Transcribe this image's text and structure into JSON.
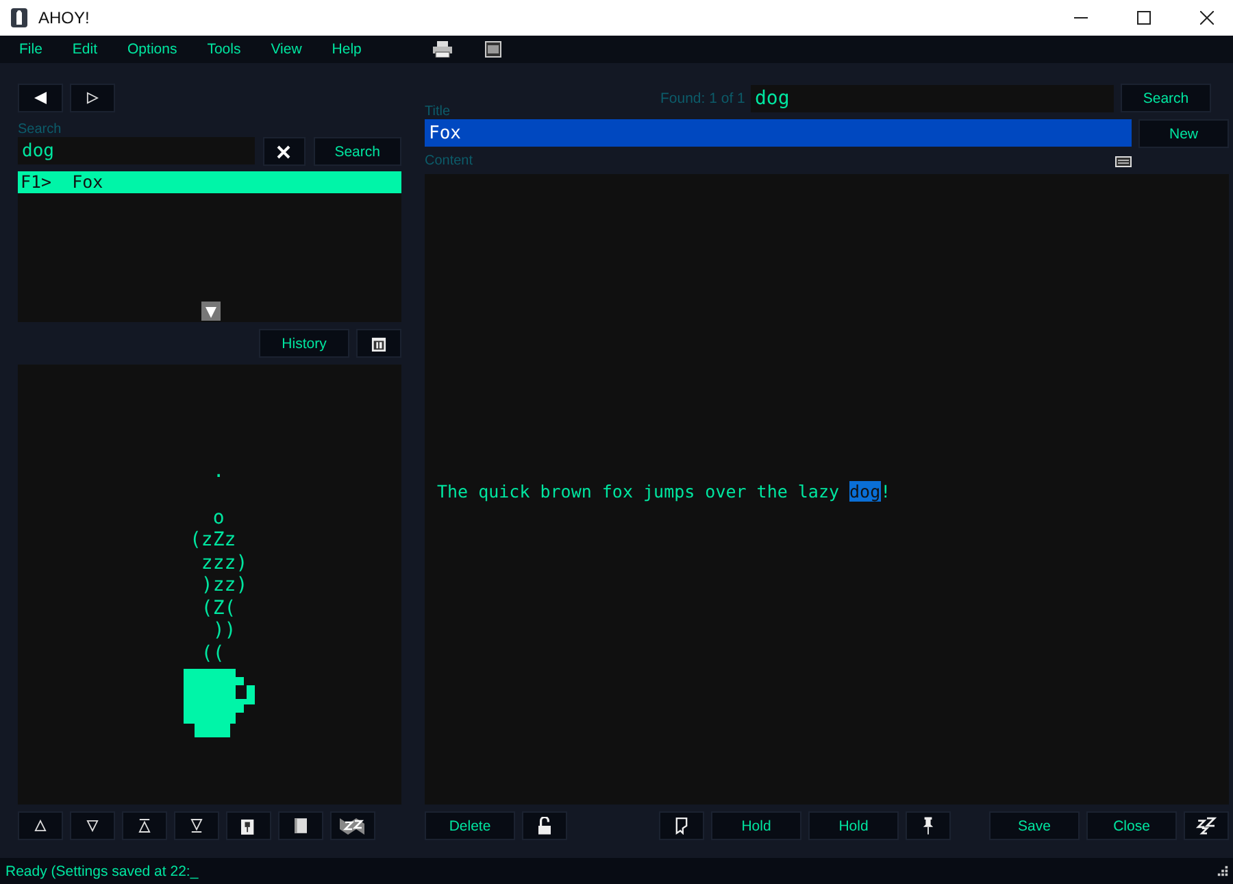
{
  "window": {
    "title": "AHOY!"
  },
  "menu": [
    "File",
    "Edit",
    "Options",
    "Tools",
    "View",
    "Help"
  ],
  "left": {
    "search_label": "Search",
    "search_value": "dog",
    "search_button": "Search",
    "results": [
      {
        "label": "F1>  Fox",
        "selected": true
      }
    ],
    "history_button": "History",
    "art_lines": [
      "  .",
      "  o",
      "(zZz",
      " zzz)",
      " )zz)",
      " (Z(",
      "  ))",
      " (("
    ]
  },
  "right": {
    "found": "Found: 1 of 1",
    "find_value": "dog",
    "search_button": "Search",
    "title_label": "Title",
    "title_value": "Fox",
    "new_button": "New",
    "content_label": "Content",
    "content": [
      {
        "text": "The quick brown fox jumps over the lazy ",
        "highlighted": false
      },
      {
        "text": "dog",
        "highlighted": true
      },
      {
        "text": "!",
        "highlighted": false
      }
    ],
    "buttons": [
      {
        "kind": "text",
        "label": "Delete"
      },
      {
        "kind": "lock"
      },
      {
        "kind": "gap"
      },
      {
        "kind": "bookmark"
      },
      {
        "kind": "text",
        "label": "Hold"
      },
      {
        "kind": "text",
        "label": "Hold"
      },
      {
        "kind": "pin"
      },
      {
        "kind": "gap"
      },
      {
        "kind": "text",
        "label": "Save"
      },
      {
        "kind": "text",
        "label": "Close"
      },
      {
        "kind": "zzz"
      }
    ]
  },
  "status_bar": "Ready (Settings saved at 22:_"
}
